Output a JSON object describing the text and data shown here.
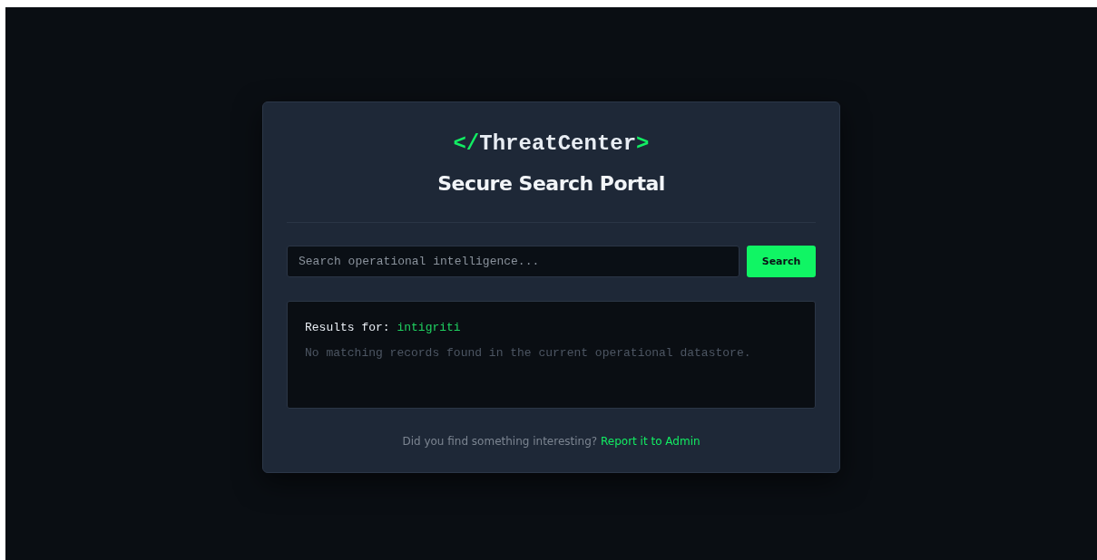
{
  "logo": {
    "prefix": "</",
    "name": "ThreatCenter",
    "suffix": ">"
  },
  "title": "Secure Search Portal",
  "search": {
    "placeholder": "Search operational intelligence...",
    "button": "Search"
  },
  "results": {
    "label": "Results for:",
    "query": "intigriti",
    "message": "No matching records found in the current operational datastore."
  },
  "footer": {
    "text": "Did you find something interesting?",
    "link": "Report it to Admin"
  }
}
